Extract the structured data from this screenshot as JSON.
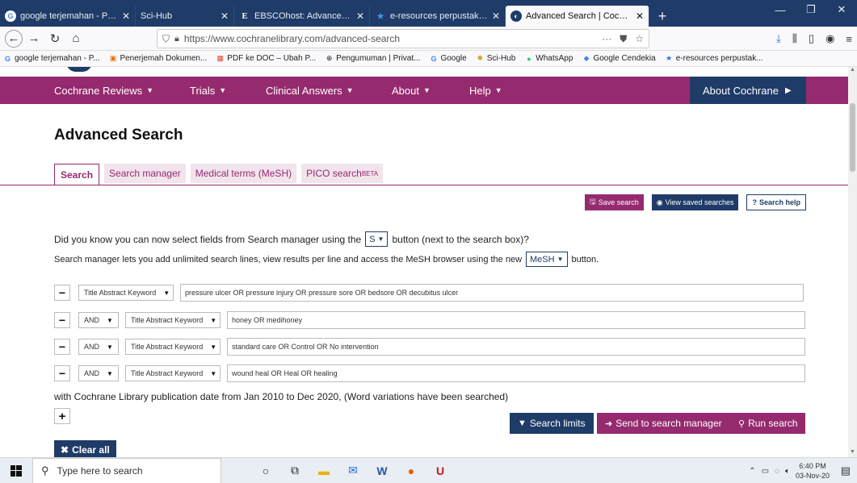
{
  "browser": {
    "tabs": [
      {
        "title": "google terjemahan - Penelusur",
        "icon": "google-icon",
        "active": false
      },
      {
        "title": "Sci-Hub",
        "icon": "",
        "active": false
      },
      {
        "title": "EBSCOhost: Advanced Search",
        "icon": "ebsco-icon",
        "active": false
      },
      {
        "title": "e-resources perpustakaan nasio",
        "icon": "star-icon",
        "active": false
      },
      {
        "title": "Advanced Search | Cochrane Li",
        "icon": "cochrane-icon",
        "active": true
      }
    ],
    "url": "https://www.cochranelibrary.com/advanced-search",
    "bookmarks": [
      {
        "label": "google terjemahan - P...",
        "icon": "google-icon"
      },
      {
        "label": "Penerjemah Dokumen...",
        "icon": "document-icon"
      },
      {
        "label": "PDF ke DOC – Ubah P...",
        "icon": "pdf-icon"
      },
      {
        "label": "Pengumuman | Privat...",
        "icon": "globe-icon"
      },
      {
        "label": "Google",
        "icon": "google-icon"
      },
      {
        "label": "Sci-Hub",
        "icon": "scihub-icon"
      },
      {
        "label": "WhatsApp",
        "icon": "whatsapp-icon"
      },
      {
        "label": "Google Cendekia",
        "icon": "scholar-icon"
      },
      {
        "label": "e-resources perpustak...",
        "icon": "star-icon"
      }
    ]
  },
  "nav": {
    "items": [
      "Cochrane Reviews",
      "Trials",
      "Clinical Answers",
      "About",
      "Help"
    ],
    "about_cochrane": "About Cochrane"
  },
  "page": {
    "title": "Advanced Search",
    "tabs": [
      {
        "label": "Search",
        "active": true
      },
      {
        "label": "Search manager",
        "active": false
      },
      {
        "label": "Medical terms (MeSH)",
        "active": false
      },
      {
        "label": "PICO search",
        "sup": "BETA",
        "active": false
      }
    ],
    "tool_buttons": {
      "save": "Save search",
      "view": "View saved searches",
      "help": "Search help"
    },
    "info_line1_a": "Did you know you can now select fields from Search manager using the",
    "info_s_button": "S",
    "info_line1_b": "button (next to the search box)?",
    "info_line2_a": "Search manager lets you add unlimited search lines, view results per line and access the MeSH browser using the new",
    "info_mesh_button": "MeSH",
    "info_line2_b": "button.",
    "rows": [
      {
        "operator": "",
        "field": "Title Abstract Keyword",
        "query": "pressure ulcer OR pressure injury OR pressure sore OR bedsore OR decubitus ulcer"
      },
      {
        "operator": "AND",
        "field": "Title Abstract Keyword",
        "query": "honey OR medihoney"
      },
      {
        "operator": "AND",
        "field": "Title Abstract Keyword",
        "query": "standard care OR Control OR No intervention"
      },
      {
        "operator": "AND",
        "field": "Title Abstract Keyword",
        "query": "wound heal OR Heal OR healing"
      }
    ],
    "pubdate": "with Cochrane Library publication date from Jan 2010 to Dec 2020, (Word variations have been searched)",
    "actions": {
      "limits": "Search limits",
      "send": "Send to search manager",
      "run": "Run search",
      "clear": "Clear all"
    }
  },
  "taskbar": {
    "search_placeholder": "Type here to search",
    "time": "6:40 PM",
    "date": "03-Nov-20"
  },
  "colors": {
    "brand_purple": "#962a6e",
    "brand_navy": "#1f3b67"
  }
}
